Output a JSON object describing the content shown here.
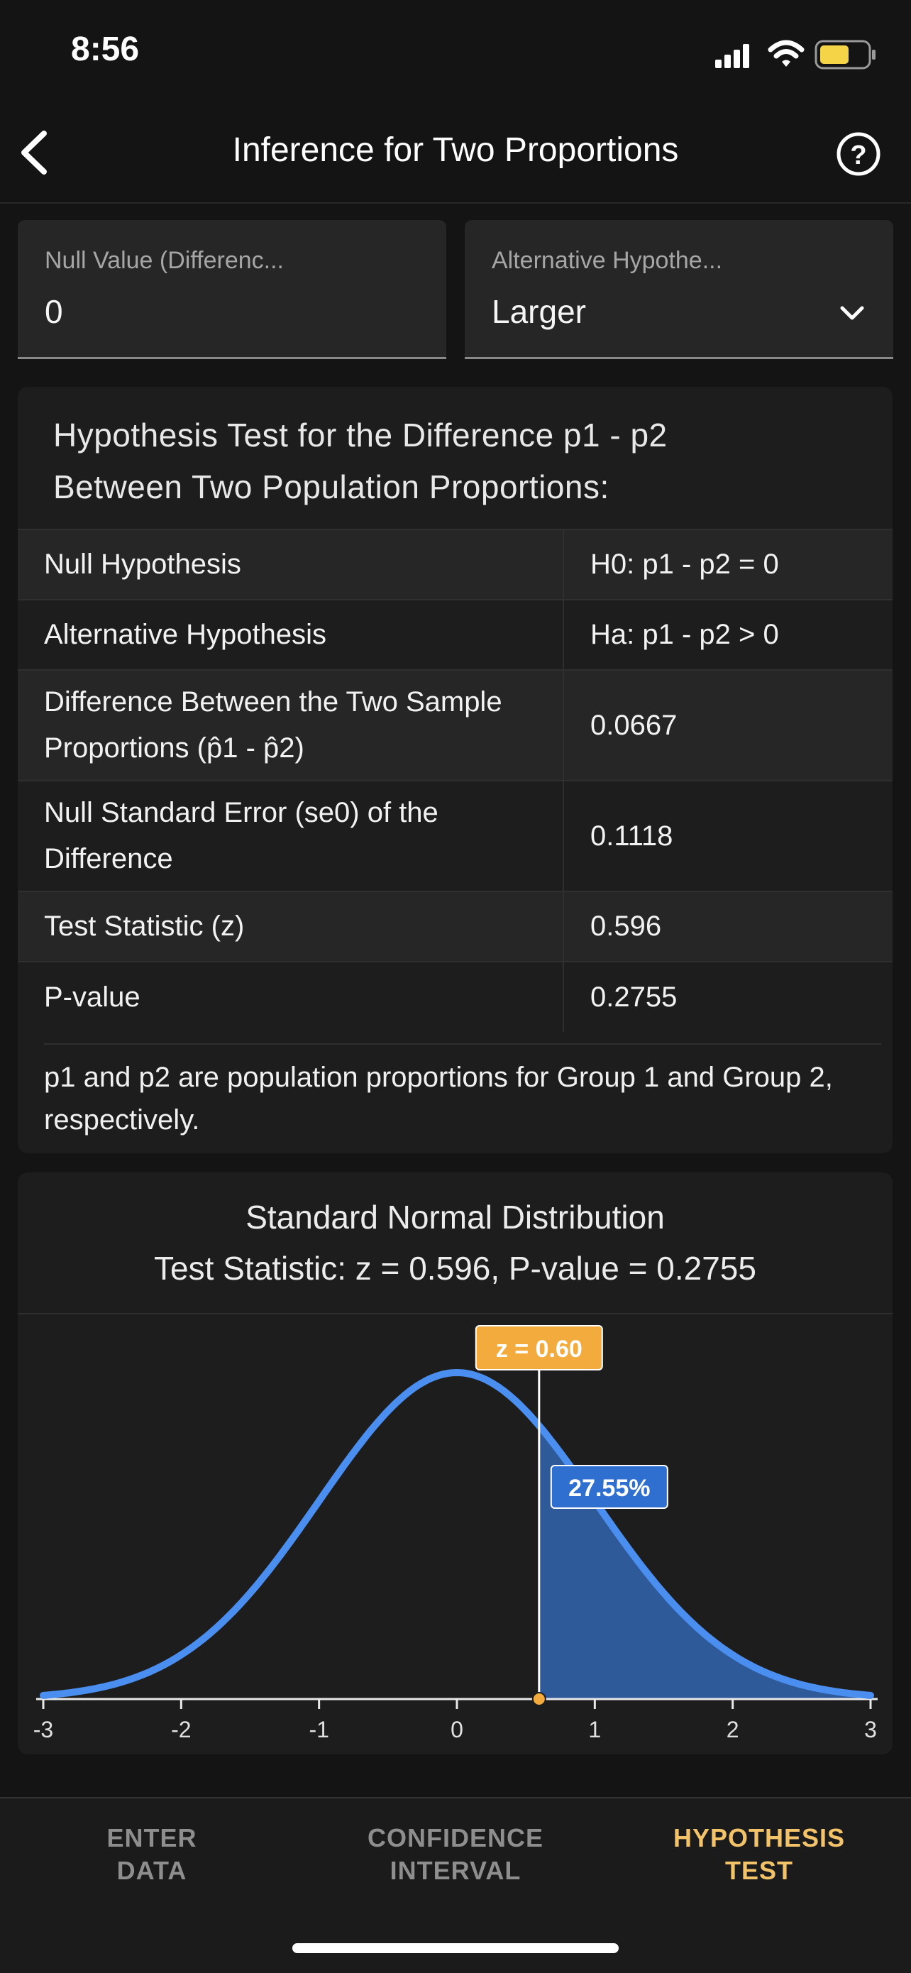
{
  "status": {
    "time": "8:56"
  },
  "nav": {
    "title": "Inference for Two Proportions",
    "back_icon": "chevron-left-icon",
    "help_icon": "question-circle-icon"
  },
  "inputs": {
    "null_value": {
      "label": "Null Value (Differenc...",
      "value": "0"
    },
    "alternative": {
      "label": "Alternative Hypothe...",
      "value": "Larger"
    }
  },
  "result": {
    "heading_line1": "Hypothesis Test for the Difference p1 - p2",
    "heading_line2": "Between Two Population Proportions:",
    "rows": [
      {
        "label": "Null Hypothesis",
        "value": "H0: p1 - p2 = 0"
      },
      {
        "label": "Alternative Hypothesis",
        "value": "Ha: p1 - p2 > 0"
      },
      {
        "label": "Difference Between the Two Sample Proportions (p̂1 - p̂2)",
        "value": "0.0667"
      },
      {
        "label": "Null Standard Error (se0) of the Difference",
        "value": "0.1118"
      },
      {
        "label": "Test Statistic (z)",
        "value": "0.596"
      },
      {
        "label": "P-value",
        "value": "0.2755"
      }
    ],
    "note": "p1 and p2 are population proportions for Group 1 and Group 2, respectively."
  },
  "chart_data": {
    "type": "area",
    "title": "Standard Normal Distribution",
    "subtitle": "Test Statistic: z = 0.596, P-value = 0.2755",
    "xlim": [
      -3,
      3
    ],
    "ticks": [
      "-3",
      "-2",
      "-1",
      "0",
      "1",
      "2",
      "3"
    ],
    "z": 0.596,
    "z_label": "z = 0.60",
    "area_label": "27.55%",
    "shaded": "right tail",
    "colors": {
      "curve": "#4a8ef0",
      "fill": "#2f5a9a",
      "z_badge": "#f2ab3c",
      "area_badge": "#2f6fd0"
    }
  },
  "tabs": [
    {
      "line1": "ENTER",
      "line2": "DATA",
      "active": false
    },
    {
      "line1": "CONFIDENCE",
      "line2": "INTERVAL",
      "active": false
    },
    {
      "line1": "HYPOTHESIS",
      "line2": "TEST",
      "active": true
    }
  ]
}
